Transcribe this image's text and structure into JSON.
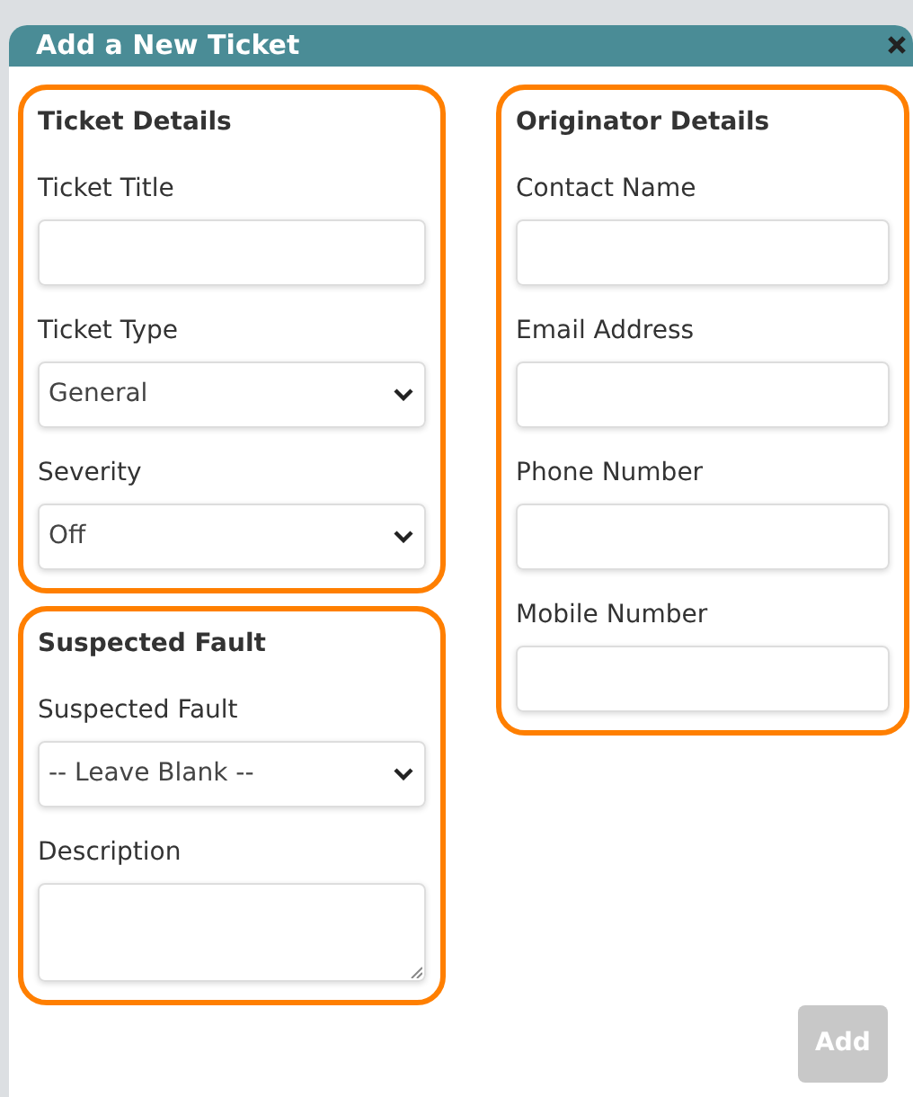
{
  "dialog": {
    "title": "Add a New Ticket"
  },
  "columns": [
    {
      "sections": [
        {
          "title": "Ticket Details",
          "fields": [
            {
              "kind": "text",
              "label": "Ticket Title"
            },
            {
              "kind": "select",
              "label": "Ticket Type",
              "value": "General"
            },
            {
              "kind": "select",
              "label": "Severity",
              "value": "Off"
            }
          ]
        },
        {
          "title": "Suspected Fault",
          "fields": [
            {
              "kind": "select",
              "label": "Suspected Fault",
              "value": "-- Leave Blank --"
            },
            {
              "kind": "textarea",
              "label": "Description"
            }
          ]
        }
      ]
    },
    {
      "sections": [
        {
          "title": "Originator Details",
          "fields": [
            {
              "kind": "text",
              "label": "Contact Name"
            },
            {
              "kind": "text",
              "label": "Email Address"
            },
            {
              "kind": "text",
              "label": "Phone Number"
            },
            {
              "kind": "text",
              "label": "Mobile Number"
            }
          ]
        }
      ]
    }
  ],
  "add_button": {
    "label": "Add",
    "disabled": true
  }
}
